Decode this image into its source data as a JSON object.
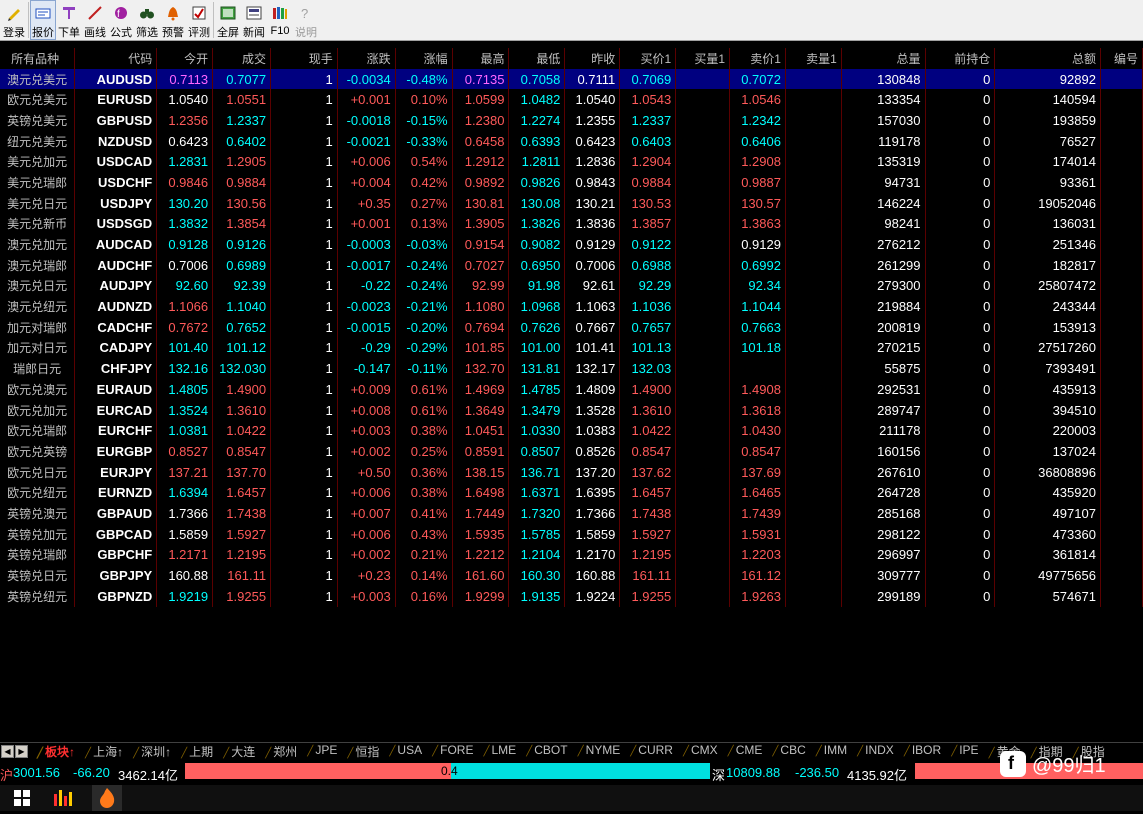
{
  "toolbar": [
    {
      "label": "登录",
      "icon": "pencil-icon"
    },
    {
      "label": "报价",
      "icon": "quote-icon",
      "active": true
    },
    {
      "label": "下单",
      "icon": "order-icon"
    },
    {
      "label": "画线",
      "icon": "draw-line-icon"
    },
    {
      "label": "公式",
      "icon": "formula-icon"
    },
    {
      "label": "筛选",
      "icon": "binoculars-icon"
    },
    {
      "label": "预警",
      "icon": "alarm-icon"
    },
    {
      "label": "评测",
      "icon": "evaluate-icon"
    },
    {
      "label": "全屏",
      "icon": "fullscreen-icon"
    },
    {
      "label": "新闻",
      "icon": "news-icon"
    },
    {
      "label": "F10",
      "icon": "books-icon"
    },
    {
      "label": "说明",
      "icon": "help-icon",
      "disabled": true
    }
  ],
  "table": {
    "headers": [
      "所有品种",
      "代码",
      "今开",
      "成交",
      "现手",
      "涨跌",
      "涨幅",
      "最高",
      "最低",
      "昨收",
      "买价1",
      "买量1",
      "卖价1",
      "卖量1",
      "总量",
      "前持仓",
      "总额",
      "编号"
    ],
    "rows": [
      {
        "name": "澳元兑美元",
        "code": "AUDUSD",
        "open": "0.7113",
        "last": "0.7077",
        "vol": "1",
        "chg": "-0.0034",
        "pct": "-0.48%",
        "high": "0.7135",
        "low": "0.7058",
        "prev": "0.7111",
        "bid": "0.7069",
        "bidv": "",
        "ask": "0.7072",
        "askv": "",
        "total": "130848",
        "oi": "0",
        "amount": "92892",
        "no": ""
      },
      {
        "name": "欧元兑美元",
        "code": "EURUSD",
        "open": "1.0540",
        "last": "1.0551",
        "vol": "1",
        "chg": "+0.001",
        "pct": "0.10%",
        "high": "1.0599",
        "low": "1.0482",
        "prev": "1.0540",
        "bid": "1.0543",
        "bidv": "",
        "ask": "1.0546",
        "askv": "",
        "total": "133354",
        "oi": "0",
        "amount": "140594",
        "no": ""
      },
      {
        "name": "英镑兑美元",
        "code": "GBPUSD",
        "open": "1.2356",
        "last": "1.2337",
        "vol": "1",
        "chg": "-0.0018",
        "pct": "-0.15%",
        "high": "1.2380",
        "low": "1.2274",
        "prev": "1.2355",
        "bid": "1.2337",
        "bidv": "",
        "ask": "1.2342",
        "askv": "",
        "total": "157030",
        "oi": "0",
        "amount": "193859",
        "no": ""
      },
      {
        "name": "纽元兑美元",
        "code": "NZDUSD",
        "open": "0.6423",
        "last": "0.6402",
        "vol": "1",
        "chg": "-0.0021",
        "pct": "-0.33%",
        "high": "0.6458",
        "low": "0.6393",
        "prev": "0.6423",
        "bid": "0.6403",
        "bidv": "",
        "ask": "0.6406",
        "askv": "",
        "total": "119178",
        "oi": "0",
        "amount": "76527",
        "no": ""
      },
      {
        "name": "美元兑加元",
        "code": "USDCAD",
        "open": "1.2831",
        "last": "1.2905",
        "vol": "1",
        "chg": "+0.006",
        "pct": "0.54%",
        "high": "1.2912",
        "low": "1.2811",
        "prev": "1.2836",
        "bid": "1.2904",
        "bidv": "",
        "ask": "1.2908",
        "askv": "",
        "total": "135319",
        "oi": "0",
        "amount": "174014",
        "no": ""
      },
      {
        "name": "美元兑瑞郎",
        "code": "USDCHF",
        "open": "0.9846",
        "last": "0.9884",
        "vol": "1",
        "chg": "+0.004",
        "pct": "0.42%",
        "high": "0.9892",
        "low": "0.9826",
        "prev": "0.9843",
        "bid": "0.9884",
        "bidv": "",
        "ask": "0.9887",
        "askv": "",
        "total": "94731",
        "oi": "0",
        "amount": "93361",
        "no": ""
      },
      {
        "name": "美元兑日元",
        "code": "USDJPY",
        "open": "130.20",
        "last": "130.56",
        "vol": "1",
        "chg": "+0.35",
        "pct": "0.27%",
        "high": "130.81",
        "low": "130.08",
        "prev": "130.21",
        "bid": "130.53",
        "bidv": "",
        "ask": "130.57",
        "askv": "",
        "total": "146224",
        "oi": "0",
        "amount": "19052046",
        "no": ""
      },
      {
        "name": "美元兑新币",
        "code": "USDSGD",
        "open": "1.3832",
        "last": "1.3854",
        "vol": "1",
        "chg": "+0.001",
        "pct": "0.13%",
        "high": "1.3905",
        "low": "1.3826",
        "prev": "1.3836",
        "bid": "1.3857",
        "bidv": "",
        "ask": "1.3863",
        "askv": "",
        "total": "98241",
        "oi": "0",
        "amount": "136031",
        "no": ""
      },
      {
        "name": "澳元兑加元",
        "code": "AUDCAD",
        "open": "0.9128",
        "last": "0.9126",
        "vol": "1",
        "chg": "-0.0003",
        "pct": "-0.03%",
        "high": "0.9154",
        "low": "0.9082",
        "prev": "0.9129",
        "bid": "0.9122",
        "bidv": "",
        "ask": "0.9129",
        "askv": "",
        "total": "276212",
        "oi": "0",
        "amount": "251346",
        "no": ""
      },
      {
        "name": "澳元兑瑞郎",
        "code": "AUDCHF",
        "open": "0.7006",
        "last": "0.6989",
        "vol": "1",
        "chg": "-0.0017",
        "pct": "-0.24%",
        "high": "0.7027",
        "low": "0.6950",
        "prev": "0.7006",
        "bid": "0.6988",
        "bidv": "",
        "ask": "0.6992",
        "askv": "",
        "total": "261299",
        "oi": "0",
        "amount": "182817",
        "no": ""
      },
      {
        "name": "澳元兑日元",
        "code": "AUDJPY",
        "open": "92.60",
        "last": "92.39",
        "vol": "1",
        "chg": "-0.22",
        "pct": "-0.24%",
        "high": "92.99",
        "low": "91.98",
        "prev": "92.61",
        "bid": "92.29",
        "bidv": "",
        "ask": "92.34",
        "askv": "",
        "total": "279300",
        "oi": "0",
        "amount": "25807472",
        "no": ""
      },
      {
        "name": "澳元兑纽元",
        "code": "AUDNZD",
        "open": "1.1066",
        "last": "1.1040",
        "vol": "1",
        "chg": "-0.0023",
        "pct": "-0.21%",
        "high": "1.1080",
        "low": "1.0968",
        "prev": "1.1063",
        "bid": "1.1036",
        "bidv": "",
        "ask": "1.1044",
        "askv": "",
        "total": "219884",
        "oi": "0",
        "amount": "243344",
        "no": ""
      },
      {
        "name": "加元对瑞郎",
        "code": "CADCHF",
        "open": "0.7672",
        "last": "0.7652",
        "vol": "1",
        "chg": "-0.0015",
        "pct": "-0.20%",
        "high": "0.7694",
        "low": "0.7626",
        "prev": "0.7667",
        "bid": "0.7657",
        "bidv": "",
        "ask": "0.7663",
        "askv": "",
        "total": "200819",
        "oi": "0",
        "amount": "153913",
        "no": ""
      },
      {
        "name": "加元对日元",
        "code": "CADJPY",
        "open": "101.40",
        "last": "101.12",
        "vol": "1",
        "chg": "-0.29",
        "pct": "-0.29%",
        "high": "101.85",
        "low": "101.00",
        "prev": "101.41",
        "bid": "101.13",
        "bidv": "",
        "ask": "101.18",
        "askv": "",
        "total": "270215",
        "oi": "0",
        "amount": "27517260",
        "no": ""
      },
      {
        "name": "瑞郎日元",
        "code": "CHFJPY",
        "open": "132.16",
        "last": "132.030",
        "vol": "1",
        "chg": "-0.147",
        "pct": "-0.11%",
        "high": "132.70",
        "low": "131.81",
        "prev": "132.17",
        "bid": "132.03",
        "bidv": "",
        "ask": "",
        "askv": "",
        "total": "55875",
        "oi": "0",
        "amount": "7393491",
        "no": ""
      },
      {
        "name": "欧元兑澳元",
        "code": "EURAUD",
        "open": "1.4805",
        "last": "1.4900",
        "vol": "1",
        "chg": "+0.009",
        "pct": "0.61%",
        "high": "1.4969",
        "low": "1.4785",
        "prev": "1.4809",
        "bid": "1.4900",
        "bidv": "",
        "ask": "1.4908",
        "askv": "",
        "total": "292531",
        "oi": "0",
        "amount": "435913",
        "no": ""
      },
      {
        "name": "欧元兑加元",
        "code": "EURCAD",
        "open": "1.3524",
        "last": "1.3610",
        "vol": "1",
        "chg": "+0.008",
        "pct": "0.61%",
        "high": "1.3649",
        "low": "1.3479",
        "prev": "1.3528",
        "bid": "1.3610",
        "bidv": "",
        "ask": "1.3618",
        "askv": "",
        "total": "289747",
        "oi": "0",
        "amount": "394510",
        "no": ""
      },
      {
        "name": "欧元兑瑞郎",
        "code": "EURCHF",
        "open": "1.0381",
        "last": "1.0422",
        "vol": "1",
        "chg": "+0.003",
        "pct": "0.38%",
        "high": "1.0451",
        "low": "1.0330",
        "prev": "1.0383",
        "bid": "1.0422",
        "bidv": "",
        "ask": "1.0430",
        "askv": "",
        "total": "211178",
        "oi": "0",
        "amount": "220003",
        "no": ""
      },
      {
        "name": "欧元兑英镑",
        "code": "EURGBP",
        "open": "0.8527",
        "last": "0.8547",
        "vol": "1",
        "chg": "+0.002",
        "pct": "0.25%",
        "high": "0.8591",
        "low": "0.8507",
        "prev": "0.8526",
        "bid": "0.8547",
        "bidv": "",
        "ask": "0.8547",
        "askv": "",
        "total": "160156",
        "oi": "0",
        "amount": "137024",
        "no": ""
      },
      {
        "name": "欧元兑日元",
        "code": "EURJPY",
        "open": "137.21",
        "last": "137.70",
        "vol": "1",
        "chg": "+0.50",
        "pct": "0.36%",
        "high": "138.15",
        "low": "136.71",
        "prev": "137.20",
        "bid": "137.62",
        "bidv": "",
        "ask": "137.69",
        "askv": "",
        "total": "267610",
        "oi": "0",
        "amount": "36808896",
        "no": ""
      },
      {
        "name": "欧元兑纽元",
        "code": "EURNZD",
        "open": "1.6394",
        "last": "1.6457",
        "vol": "1",
        "chg": "+0.006",
        "pct": "0.38%",
        "high": "1.6498",
        "low": "1.6371",
        "prev": "1.6395",
        "bid": "1.6457",
        "bidv": "",
        "ask": "1.6465",
        "askv": "",
        "total": "264728",
        "oi": "0",
        "amount": "435920",
        "no": ""
      },
      {
        "name": "英镑兑澳元",
        "code": "GBPAUD",
        "open": "1.7366",
        "last": "1.7438",
        "vol": "1",
        "chg": "+0.007",
        "pct": "0.41%",
        "high": "1.7449",
        "low": "1.7320",
        "prev": "1.7366",
        "bid": "1.7438",
        "bidv": "",
        "ask": "1.7439",
        "askv": "",
        "total": "285168",
        "oi": "0",
        "amount": "497107",
        "no": ""
      },
      {
        "name": "英镑兑加元",
        "code": "GBPCAD",
        "open": "1.5859",
        "last": "1.5927",
        "vol": "1",
        "chg": "+0.006",
        "pct": "0.43%",
        "high": "1.5935",
        "low": "1.5785",
        "prev": "1.5859",
        "bid": "1.5927",
        "bidv": "",
        "ask": "1.5931",
        "askv": "",
        "total": "298122",
        "oi": "0",
        "amount": "473360",
        "no": ""
      },
      {
        "name": "英镑兑瑞郎",
        "code": "GBPCHF",
        "open": "1.2171",
        "last": "1.2195",
        "vol": "1",
        "chg": "+0.002",
        "pct": "0.21%",
        "high": "1.2212",
        "low": "1.2104",
        "prev": "1.2170",
        "bid": "1.2195",
        "bidv": "",
        "ask": "1.2203",
        "askv": "",
        "total": "296997",
        "oi": "0",
        "amount": "361814",
        "no": ""
      },
      {
        "name": "英镑兑日元",
        "code": "GBPJPY",
        "open": "160.88",
        "last": "161.11",
        "vol": "1",
        "chg": "+0.23",
        "pct": "0.14%",
        "high": "161.60",
        "low": "160.30",
        "prev": "160.88",
        "bid": "161.11",
        "bidv": "",
        "ask": "161.12",
        "askv": "",
        "total": "309777",
        "oi": "0",
        "amount": "49775656",
        "no": ""
      },
      {
        "name": "英镑兑纽元",
        "code": "GBPNZD",
        "open": "1.9219",
        "last": "1.9255",
        "vol": "1",
        "chg": "+0.003",
        "pct": "0.16%",
        "high": "1.9299",
        "low": "1.9135",
        "prev": "1.9224",
        "bid": "1.9255",
        "bidv": "",
        "ask": "1.9263",
        "askv": "",
        "total": "299189",
        "oi": "0",
        "amount": "574671",
        "no": ""
      }
    ]
  },
  "tabs": [
    {
      "label": "板块↑",
      "active": true
    },
    {
      "label": "上海↑"
    },
    {
      "label": "深圳↑"
    },
    {
      "label": "上期"
    },
    {
      "label": "大连"
    },
    {
      "label": "郑州"
    },
    {
      "label": "JPE"
    },
    {
      "label": "恒指"
    },
    {
      "label": "USA"
    },
    {
      "label": "FORE"
    },
    {
      "label": "LME"
    },
    {
      "label": "CBOT"
    },
    {
      "label": "NYME"
    },
    {
      "label": "CURR"
    },
    {
      "label": "CMX"
    },
    {
      "label": "CME"
    },
    {
      "label": "CBC"
    },
    {
      "label": "IMM"
    },
    {
      "label": "INDX"
    },
    {
      "label": "IBOR"
    },
    {
      "label": "IPE"
    },
    {
      "label": "黄金"
    },
    {
      "label": "指期"
    },
    {
      "label": "股指"
    }
  ],
  "status": {
    "sh_prefix": "沪",
    "sh_index": "3001.56",
    "sh_change": "-66.20",
    "sh_amount": "3462.14亿",
    "bar_value": "0.4",
    "sz_prefix": "深",
    "sz_index": "10809.88",
    "sz_change": "-236.50",
    "sz_amount": "4135.92亿"
  },
  "watermark": "@99归1",
  "colors": {
    "up": "#ff5a5a",
    "down": "#00ffff",
    "flat": "#ffffff",
    "selected_row": "#000080",
    "grid": "#5a0000"
  }
}
